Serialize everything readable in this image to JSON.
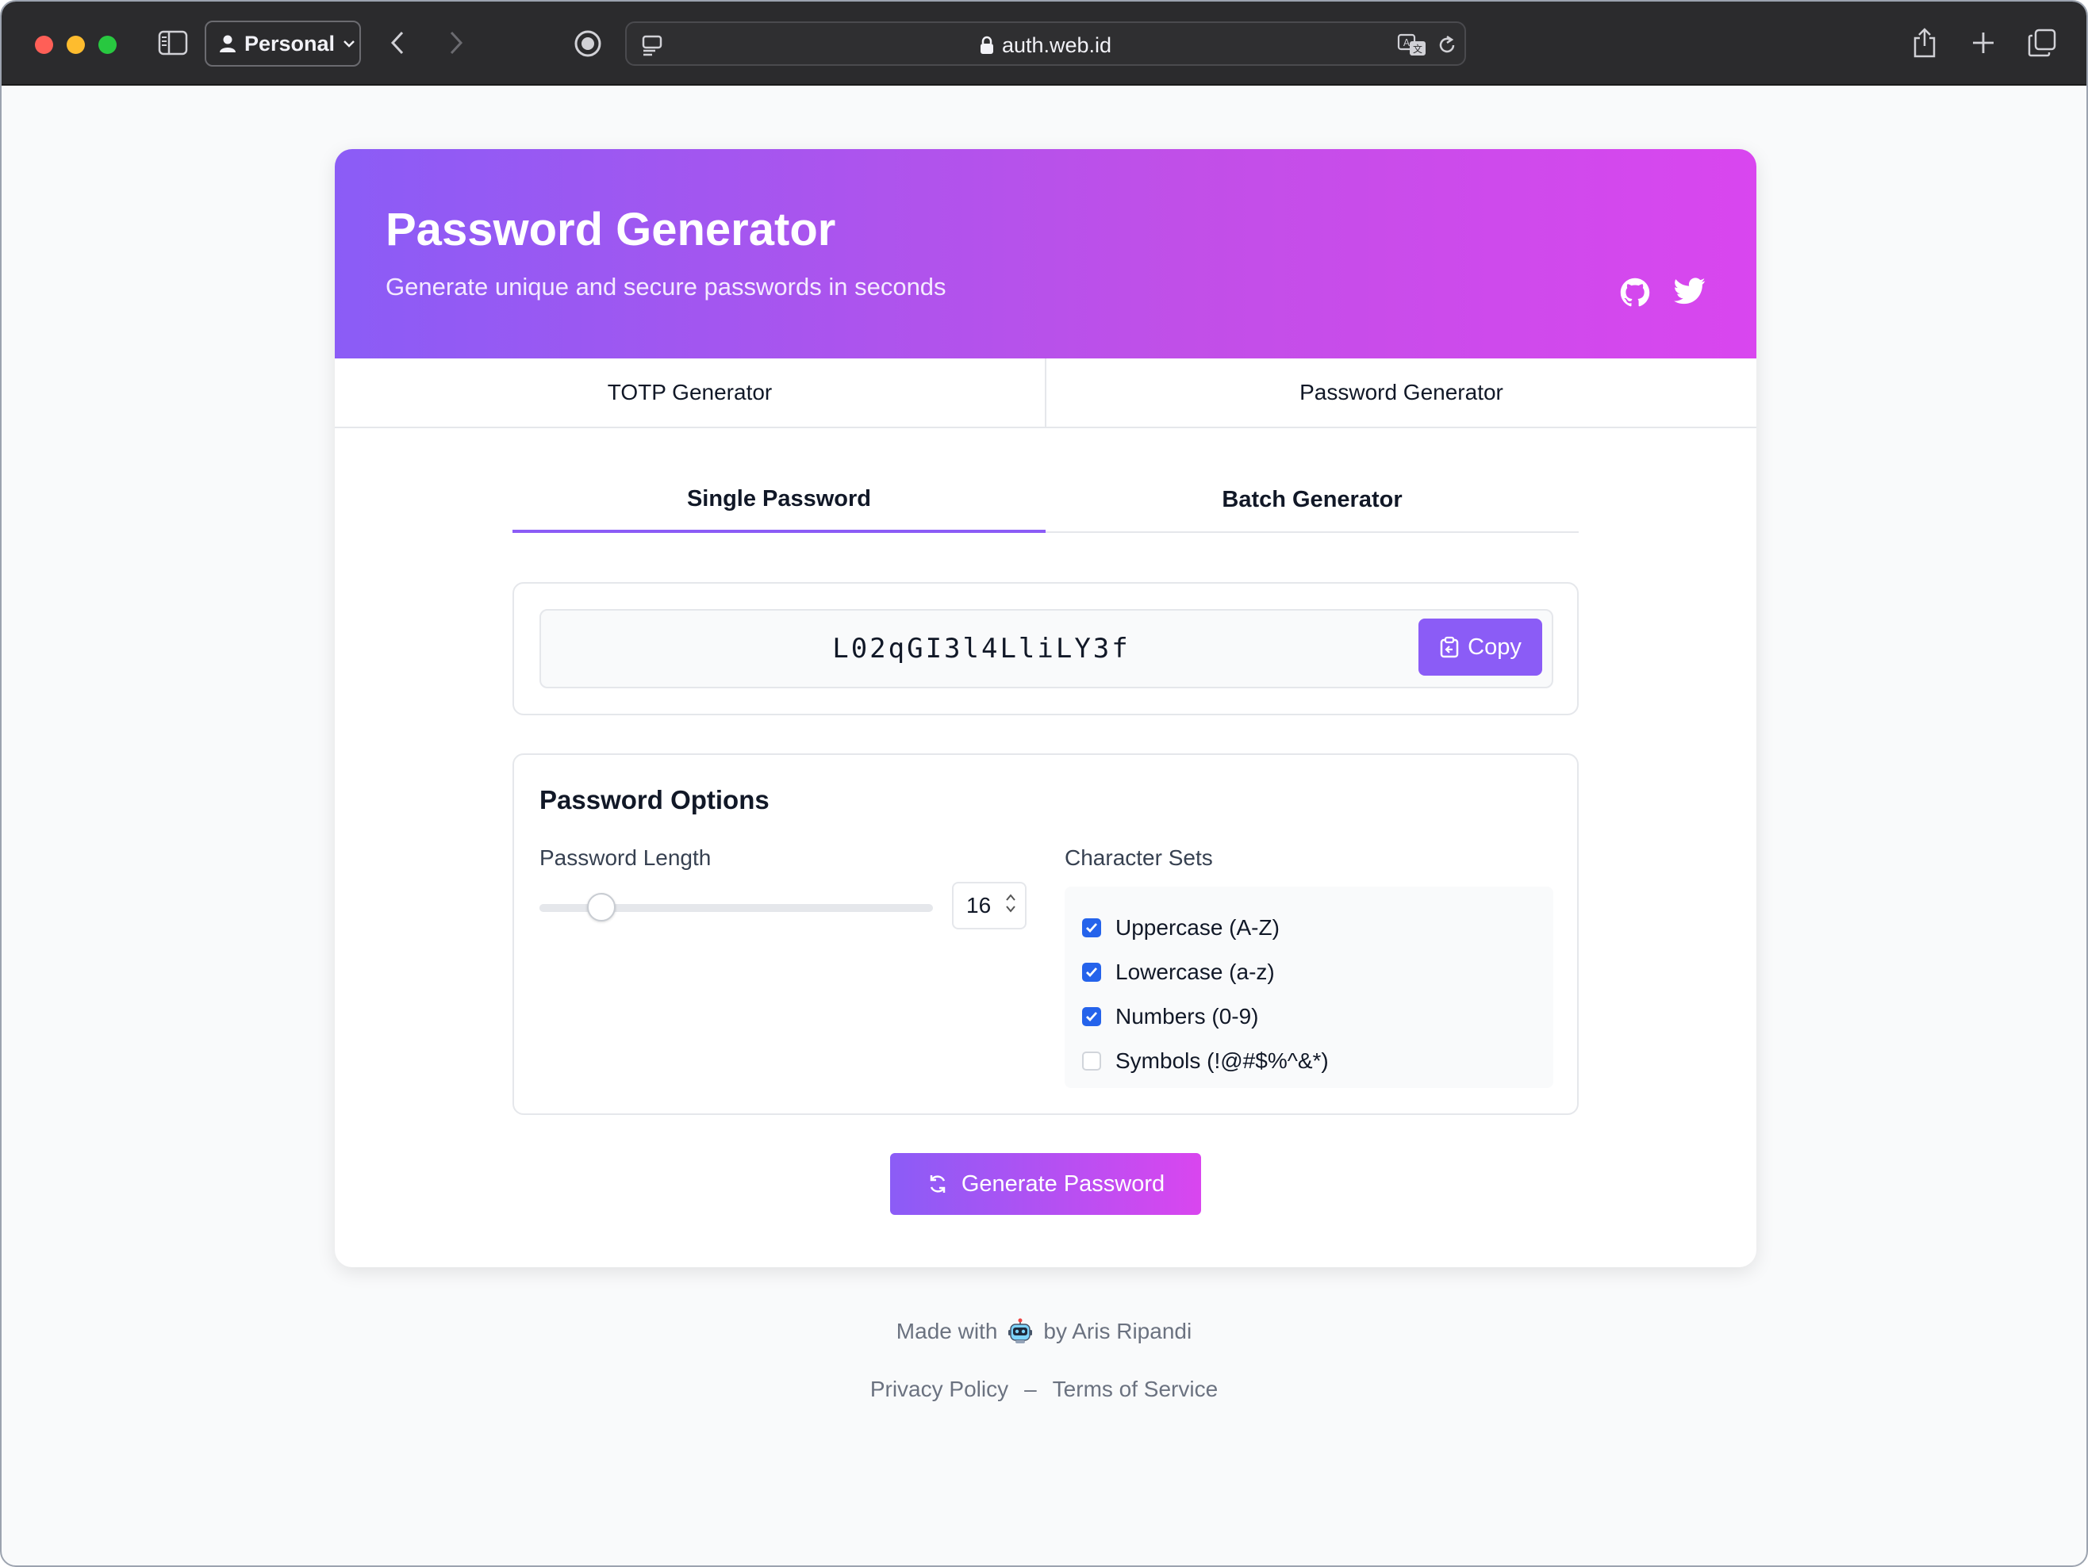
{
  "browser": {
    "profile_label": "Personal",
    "url": "auth.web.id"
  },
  "header": {
    "title": "Password Generator",
    "subtitle": "Generate unique and secure passwords in seconds",
    "icons": [
      "github-icon",
      "twitter-icon"
    ]
  },
  "main_tabs": [
    {
      "label": "TOTP Generator"
    },
    {
      "label": "Password Generator"
    }
  ],
  "sub_tabs": [
    {
      "label": "Single Password",
      "active": true
    },
    {
      "label": "Batch Generator",
      "active": false
    }
  ],
  "output": {
    "password": "L02qGI3l4LliLY3f",
    "copy_label": "Copy"
  },
  "options": {
    "title": "Password Options",
    "length_label": "Password Length",
    "length_value": "16",
    "length_min": 8,
    "length_max": 128,
    "charsets_label": "Character Sets",
    "charsets": [
      {
        "label": "Uppercase (A-Z)",
        "checked": true
      },
      {
        "label": "Lowercase (a-z)",
        "checked": true
      },
      {
        "label": "Numbers (0-9)",
        "checked": true
      },
      {
        "label": "Symbols (!@#$%^&*)",
        "checked": false
      }
    ]
  },
  "generate_label": "Generate Password",
  "footer": {
    "made_with": "Made with",
    "by": "by Aris Ripandi",
    "privacy": "Privacy Policy",
    "separator": "–",
    "terms": "Terms of Service"
  },
  "colors": {
    "accent": "#8b5cf6",
    "accent_end": "#d946ef",
    "checkbox": "#2563eb"
  }
}
